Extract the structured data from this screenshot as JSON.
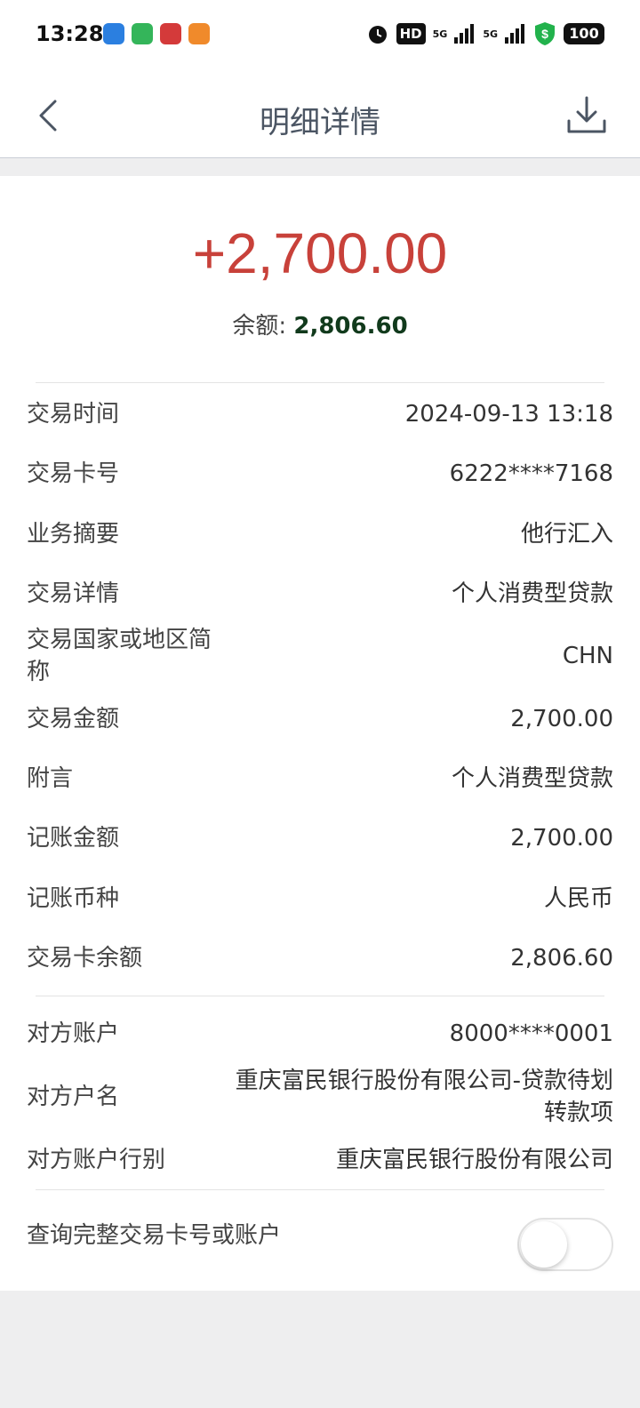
{
  "status_bar": {
    "time": "13:28",
    "hd": "HD",
    "sim_a": "5G",
    "sim_b": "5G",
    "battery": "100"
  },
  "nav": {
    "title": "明细详情"
  },
  "summary": {
    "amount": "+2,700.00",
    "balance_label": "余额: ",
    "balance_value": "2,806.60",
    "amount_color": "#c8413a"
  },
  "details": {
    "trade_time": {
      "label": "交易时间",
      "value": "2024-09-13 13:18"
    },
    "card_no": {
      "label": "交易卡号",
      "value": "6222****7168"
    },
    "summary": {
      "label": "业务摘要",
      "value": "他行汇入"
    },
    "trade_detail": {
      "label": "交易详情",
      "value": "个人消费型贷款"
    },
    "country": {
      "label": "交易国家或地区简称",
      "value": "CHN"
    },
    "trade_amount": {
      "label": "交易金额",
      "value": "2,700.00"
    },
    "remark": {
      "label": "附言",
      "value": "个人消费型贷款"
    },
    "book_amount": {
      "label": "记账金额",
      "value": "2,700.00"
    },
    "book_currency": {
      "label": "记账币种",
      "value": "人民币"
    },
    "card_balance": {
      "label": "交易卡余额",
      "value": "2,806.60"
    }
  },
  "counterparty": {
    "account": {
      "label": "对方账户",
      "value": "8000****0001"
    },
    "name": {
      "label": "对方户名",
      "value": "重庆富民银行股份有限公司-贷款待划转款项"
    },
    "bank": {
      "label": "对方账户行别",
      "value": "重庆富民银行股份有限公司"
    }
  },
  "toggle": {
    "label": "查询完整交易卡号或账户",
    "state": "off"
  }
}
